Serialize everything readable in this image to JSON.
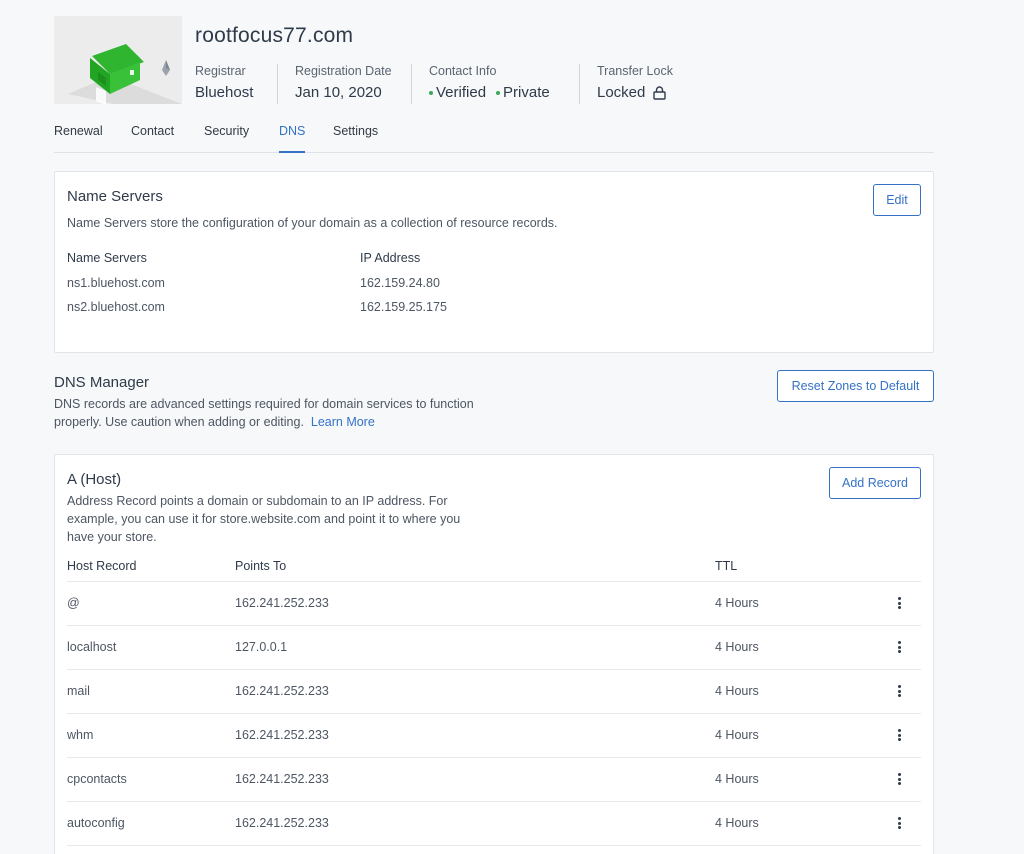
{
  "domain": {
    "name": "rootfocus77.com",
    "registrar_label": "Registrar",
    "registrar": "Bluehost",
    "reg_date_label": "Registration Date",
    "reg_date": "Jan 10, 2020",
    "contact_label": "Contact Info",
    "contact_verified": "Verified",
    "contact_private": "Private",
    "transfer_label": "Transfer Lock",
    "transfer": "Locked"
  },
  "tabs": [
    {
      "label": "Renewal"
    },
    {
      "label": "Contact"
    },
    {
      "label": "Security"
    },
    {
      "label": "DNS",
      "active": true
    },
    {
      "label": "Settings"
    }
  ],
  "name_servers": {
    "title": "Name Servers",
    "description": "Name Servers store the configuration of your domain as a collection of resource records.",
    "edit_label": "Edit",
    "col_ns": "Name Servers",
    "col_ip": "IP Address",
    "rows": [
      {
        "ns": "ns1.bluehost.com",
        "ip": "162.159.24.80"
      },
      {
        "ns": "ns2.bluehost.com",
        "ip": "162.159.25.175"
      }
    ]
  },
  "dns_manager": {
    "title": "DNS Manager",
    "description": "DNS records are advanced settings required for domain services to function properly. Use caution when adding or editing.",
    "learn_more": "Learn More",
    "reset_label": "Reset Zones to Default"
  },
  "a_host": {
    "title": "A (Host)",
    "description": "Address Record points a domain or subdomain to an IP address. For example, you can use it for store.website.com and point it to where you have your store.",
    "add_label": "Add Record",
    "col_host": "Host Record",
    "col_points": "Points To",
    "col_ttl": "TTL",
    "rows": [
      {
        "host": "@",
        "points": "162.241.252.233",
        "ttl": "4 Hours"
      },
      {
        "host": "localhost",
        "points": "127.0.0.1",
        "ttl": "4 Hours"
      },
      {
        "host": "mail",
        "points": "162.241.252.233",
        "ttl": "4 Hours"
      },
      {
        "host": "whm",
        "points": "162.241.252.233",
        "ttl": "4 Hours"
      },
      {
        "host": "cpcontacts",
        "points": "162.241.252.233",
        "ttl": "4 Hours"
      },
      {
        "host": "autoconfig",
        "points": "162.241.252.233",
        "ttl": "4 Hours"
      }
    ]
  },
  "colors": {
    "accent": "#3572c6",
    "status_green": "#3aa85a",
    "logo_green": "#2fb52f"
  },
  "icons": {
    "logo": "green-house-icon",
    "lock": "lock-icon",
    "row_menu": "kebab-menu-icon"
  }
}
